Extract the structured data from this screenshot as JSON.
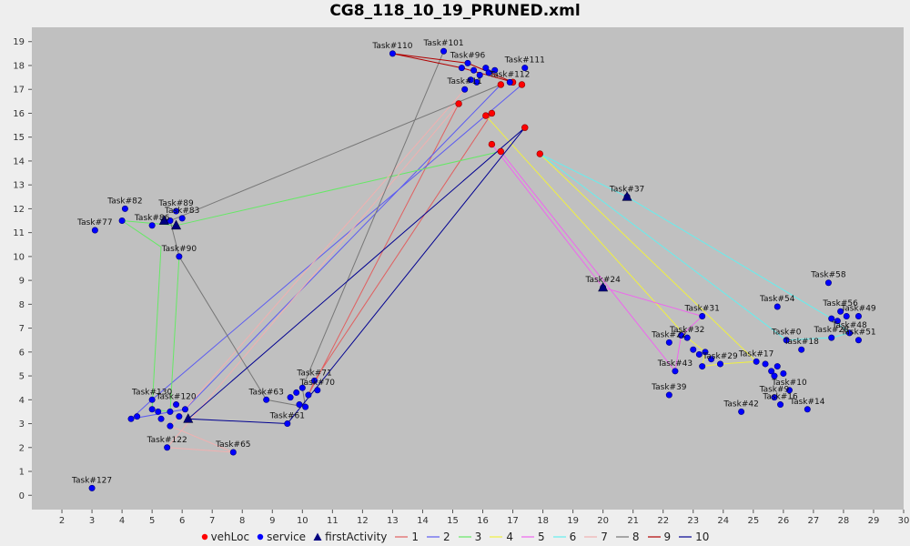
{
  "chart_data": {
    "type": "scatter",
    "title": "CG8_118_10_19_PRUNED.xml",
    "xlabel": "",
    "ylabel": "",
    "xlim": [
      1,
      30
    ],
    "ylim": [
      -0.6,
      19.6
    ],
    "xticks": [
      2,
      3,
      4,
      5,
      6,
      7,
      8,
      9,
      10,
      11,
      12,
      13,
      14,
      15,
      16,
      17,
      18,
      19,
      20,
      21,
      22,
      23,
      24,
      25,
      26,
      27,
      28,
      29,
      30
    ],
    "yticks": [
      0,
      1,
      2,
      3,
      4,
      5,
      6,
      7,
      8,
      9,
      10,
      11,
      12,
      13,
      14,
      15,
      16,
      17,
      18,
      19
    ],
    "grid": false,
    "legend_position": "bottom",
    "colors": {
      "plot_bg": "#c0c0c0",
      "vehLoc": "#ff0000",
      "service": "#0000ff",
      "firstActivity": "#000080",
      "1": "#e06060",
      "2": "#5c5cf0",
      "3": "#66e866",
      "4": "#f0f040",
      "5": "#ee66ee",
      "6": "#66eeee",
      "7": "#f0b0b0",
      "8": "#777777",
      "9": "#b00000",
      "10": "#000090"
    },
    "legend": [
      {
        "key": "vehLoc",
        "label": "vehLoc",
        "symbol": "dot"
      },
      {
        "key": "service",
        "label": "service",
        "symbol": "dot"
      },
      {
        "key": "firstActivity",
        "label": "firstActivity",
        "symbol": "triangle"
      },
      {
        "key": "1",
        "label": "1",
        "symbol": "line"
      },
      {
        "key": "2",
        "label": "2",
        "symbol": "line"
      },
      {
        "key": "3",
        "label": "3",
        "symbol": "line"
      },
      {
        "key": "4",
        "label": "4",
        "symbol": "line"
      },
      {
        "key": "5",
        "label": "5",
        "symbol": "line"
      },
      {
        "key": "6",
        "label": "6",
        "symbol": "line"
      },
      {
        "key": "7",
        "label": "7",
        "symbol": "line"
      },
      {
        "key": "8",
        "label": "8",
        "symbol": "line"
      },
      {
        "key": "9",
        "label": "9",
        "symbol": "line"
      },
      {
        "key": "10",
        "label": "10",
        "symbol": "line"
      }
    ],
    "vehLoc": [
      [
        15.2,
        16.4
      ],
      [
        16.1,
        15.9
      ],
      [
        16.3,
        16.0
      ],
      [
        16.6,
        17.2
      ],
      [
        17.3,
        17.2
      ],
      [
        16.3,
        14.7
      ],
      [
        16.6,
        14.4
      ],
      [
        17.4,
        15.4
      ],
      [
        17.9,
        14.3
      ],
      [
        17.0,
        17.3
      ]
    ],
    "service": [
      {
        "label": "Task#110",
        "x": 13.0,
        "y": 18.5
      },
      {
        "label": "Task#101",
        "x": 14.7,
        "y": 18.6
      },
      {
        "label": "Task#96",
        "x": 15.5,
        "y": 18.1
      },
      {
        "label": "",
        "x": 15.3,
        "y": 17.9
      },
      {
        "label": "",
        "x": 15.7,
        "y": 17.8
      },
      {
        "label": "",
        "x": 15.9,
        "y": 17.6
      },
      {
        "label": "",
        "x": 16.1,
        "y": 17.9
      },
      {
        "label": "",
        "x": 15.6,
        "y": 17.4
      },
      {
        "label": "",
        "x": 15.8,
        "y": 17.3
      },
      {
        "label": "",
        "x": 16.2,
        "y": 17.7
      },
      {
        "label": "",
        "x": 16.4,
        "y": 17.8
      },
      {
        "label": "Task#111",
        "x": 17.4,
        "y": 17.9
      },
      {
        "label": "Task#112",
        "x": 16.9,
        "y": 17.3
      },
      {
        "label": "Task#11",
        "x": 15.4,
        "y": 17.0
      },
      {
        "label": "Task#82",
        "x": 4.1,
        "y": 12.0
      },
      {
        "label": "Task#89",
        "x": 5.8,
        "y": 11.9
      },
      {
        "label": "Task#86",
        "x": 5.0,
        "y": 11.3
      },
      {
        "label": "Task#77",
        "x": 3.1,
        "y": 11.1
      },
      {
        "label": "",
        "x": 4.0,
        "y": 11.5
      },
      {
        "label": "",
        "x": 5.4,
        "y": 11.5
      },
      {
        "label": "",
        "x": 5.6,
        "y": 11.5
      },
      {
        "label": "Task#83",
        "x": 6.0,
        "y": 11.6
      },
      {
        "label": "Task#90",
        "x": 5.9,
        "y": 10.0
      },
      {
        "label": "Task#130",
        "x": 5.0,
        "y": 4.0
      },
      {
        "label": "Task#120",
        "x": 5.8,
        "y": 3.8
      },
      {
        "label": "",
        "x": 4.3,
        "y": 3.2
      },
      {
        "label": "",
        "x": 4.5,
        "y": 3.3
      },
      {
        "label": "",
        "x": 5.0,
        "y": 3.6
      },
      {
        "label": "",
        "x": 5.2,
        "y": 3.5
      },
      {
        "label": "",
        "x": 5.3,
        "y": 3.2
      },
      {
        "label": "",
        "x": 5.6,
        "y": 3.5
      },
      {
        "label": "",
        "x": 5.9,
        "y": 3.3
      },
      {
        "label": "",
        "x": 6.1,
        "y": 3.6
      },
      {
        "label": "",
        "x": 5.6,
        "y": 2.9
      },
      {
        "label": "Task#122",
        "x": 5.5,
        "y": 2.0
      },
      {
        "label": "Task#65",
        "x": 7.7,
        "y": 1.8
      },
      {
        "label": "Task#127",
        "x": 3.0,
        "y": 0.3
      },
      {
        "label": "Task#71",
        "x": 10.4,
        "y": 4.8
      },
      {
        "label": "Task#70",
        "x": 10.5,
        "y": 4.4
      },
      {
        "label": "Task#63",
        "x": 8.8,
        "y": 4.0
      },
      {
        "label": "",
        "x": 9.6,
        "y": 4.1
      },
      {
        "label": "",
        "x": 9.8,
        "y": 4.3
      },
      {
        "label": "",
        "x": 10.0,
        "y": 4.5
      },
      {
        "label": "",
        "x": 10.2,
        "y": 4.2
      },
      {
        "label": "",
        "x": 9.9,
        "y": 3.8
      },
      {
        "label": "",
        "x": 10.1,
        "y": 3.7
      },
      {
        "label": "Task#61",
        "x": 9.5,
        "y": 3.0
      },
      {
        "label": "Task#37",
        "x": 20.8,
        "y": 12.5
      },
      {
        "label": "Task#24",
        "x": 20.0,
        "y": 8.7
      },
      {
        "label": "Task#58",
        "x": 27.5,
        "y": 8.9
      },
      {
        "label": "Task#54",
        "x": 25.8,
        "y": 7.9
      },
      {
        "label": "Task#31",
        "x": 23.3,
        "y": 7.5
      },
      {
        "label": "Task#56",
        "x": 27.9,
        "y": 7.7
      },
      {
        "label": "Task#49",
        "x": 28.5,
        "y": 7.5
      },
      {
        "label": "",
        "x": 27.6,
        "y": 7.4
      },
      {
        "label": "",
        "x": 27.8,
        "y": 7.3
      },
      {
        "label": "",
        "x": 28.1,
        "y": 7.5
      },
      {
        "label": "Task#48",
        "x": 28.2,
        "y": 6.8
      },
      {
        "label": "Task#51",
        "x": 28.5,
        "y": 6.5
      },
      {
        "label": "Task#28",
        "x": 27.6,
        "y": 6.6
      },
      {
        "label": "Task#0",
        "x": 26.1,
        "y": 6.5
      },
      {
        "label": "Task#18",
        "x": 26.6,
        "y": 6.1
      },
      {
        "label": "Task#22",
        "x": 22.2,
        "y": 6.4
      },
      {
        "label": "Task#32",
        "x": 22.8,
        "y": 6.6
      },
      {
        "label": "",
        "x": 22.6,
        "y": 6.7
      },
      {
        "label": "",
        "x": 23.0,
        "y": 6.1
      },
      {
        "label": "",
        "x": 23.2,
        "y": 5.9
      },
      {
        "label": "",
        "x": 23.4,
        "y": 6.0
      },
      {
        "label": "",
        "x": 23.6,
        "y": 5.7
      },
      {
        "label": "",
        "x": 23.3,
        "y": 5.4
      },
      {
        "label": "Task#29",
        "x": 23.9,
        "y": 5.5
      },
      {
        "label": "Task#43",
        "x": 22.4,
        "y": 5.2
      },
      {
        "label": "Task#17",
        "x": 25.1,
        "y": 5.6
      },
      {
        "label": "",
        "x": 25.4,
        "y": 5.5
      },
      {
        "label": "",
        "x": 25.6,
        "y": 5.2
      },
      {
        "label": "",
        "x": 25.8,
        "y": 5.4
      },
      {
        "label": "",
        "x": 26.0,
        "y": 5.1
      },
      {
        "label": "",
        "x": 25.7,
        "y": 5.0
      },
      {
        "label": "Task#10",
        "x": 26.2,
        "y": 4.4
      },
      {
        "label": "Task#9",
        "x": 25.7,
        "y": 4.1
      },
      {
        "label": "Task#16",
        "x": 25.9,
        "y": 3.8
      },
      {
        "label": "Task#14",
        "x": 26.8,
        "y": 3.6
      },
      {
        "label": "Task#42",
        "x": 24.6,
        "y": 3.5
      },
      {
        "label": "Task#39",
        "x": 22.2,
        "y": 4.2
      }
    ],
    "firstActivity": [
      {
        "x": 5.8,
        "y": 11.3
      },
      {
        "x": 5.4,
        "y": 11.5
      },
      {
        "x": 6.2,
        "y": 3.2
      },
      {
        "x": 20.8,
        "y": 12.5
      },
      {
        "x": 20.0,
        "y": 8.7
      }
    ],
    "routes": [
      {
        "name": "1",
        "points": [
          [
            16.3,
            16.0
          ],
          [
            10.4,
            4.8
          ],
          [
            10.2,
            4.2
          ],
          [
            15.2,
            16.4
          ]
        ]
      },
      {
        "name": "2",
        "points": [
          [
            17.3,
            17.2
          ],
          [
            5.0,
            4.0
          ],
          [
            4.3,
            3.2
          ],
          [
            6.1,
            3.6
          ],
          [
            16.6,
            17.2
          ]
        ]
      },
      {
        "name": "3",
        "points": [
          [
            16.6,
            14.4
          ],
          [
            5.8,
            11.3
          ],
          [
            4.0,
            11.5
          ],
          [
            5.3,
            10.4
          ],
          [
            5.0,
            3.6
          ],
          [
            5.6,
            3.5
          ],
          [
            5.9,
            10.0
          ]
        ]
      },
      {
        "name": "4",
        "points": [
          [
            16.1,
            15.9
          ],
          [
            22.8,
            6.6
          ],
          [
            23.4,
            6.0
          ],
          [
            23.3,
            5.4
          ],
          [
            23.9,
            5.5
          ],
          [
            25.1,
            5.6
          ],
          [
            17.9,
            14.3
          ]
        ]
      },
      {
        "name": "5",
        "points": [
          [
            16.3,
            14.7
          ],
          [
            20.0,
            8.7
          ],
          [
            23.3,
            7.5
          ],
          [
            22.6,
            6.7
          ],
          [
            22.4,
            5.2
          ],
          [
            16.6,
            14.4
          ]
        ]
      },
      {
        "name": "6",
        "points": [
          [
            17.9,
            14.3
          ],
          [
            20.8,
            12.5
          ],
          [
            27.6,
            7.4
          ],
          [
            28.2,
            6.8
          ],
          [
            27.6,
            6.6
          ],
          [
            26.1,
            6.5
          ],
          [
            17.9,
            14.3
          ]
        ]
      },
      {
        "name": "7",
        "points": [
          [
            15.2,
            16.4
          ],
          [
            5.5,
            2.0
          ],
          [
            7.7,
            1.8
          ],
          [
            5.6,
            2.9
          ],
          [
            15.4,
            17.0
          ]
        ]
      },
      {
        "name": "8",
        "points": [
          [
            14.7,
            18.6
          ],
          [
            10.0,
            4.5
          ],
          [
            10.1,
            3.7
          ],
          [
            8.8,
            4.0
          ],
          [
            5.9,
            10.0
          ],
          [
            5.6,
            11.5
          ],
          [
            16.6,
            17.2
          ]
        ]
      },
      {
        "name": "9",
        "points": [
          [
            13.0,
            18.5
          ],
          [
            15.5,
            18.1
          ],
          [
            17.0,
            17.3
          ],
          [
            15.3,
            17.9
          ],
          [
            13.0,
            18.5
          ]
        ]
      },
      {
        "name": "10",
        "points": [
          [
            17.4,
            15.4
          ],
          [
            6.2,
            3.2
          ],
          [
            9.5,
            3.0
          ],
          [
            10.4,
            4.4
          ],
          [
            17.4,
            15.4
          ]
        ]
      }
    ]
  }
}
